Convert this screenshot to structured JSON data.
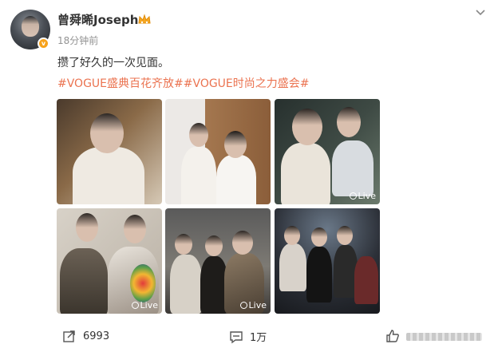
{
  "post": {
    "username": "曾舜晞Joseph",
    "timestamp": "18分钟前",
    "text": "攒了好久的一次见面。",
    "hashtags": "#VOGUE盛典百花齐放##VOGUE时尚之力盛会#"
  },
  "photos": [
    {
      "live": ""
    },
    {
      "live": ""
    },
    {
      "live": "Live"
    },
    {
      "live": "Live"
    },
    {
      "live": "Live"
    },
    {
      "live": ""
    }
  ],
  "actions": {
    "share_count": "6993",
    "comment_count": "1万"
  },
  "colors": {
    "hashtag": "#eb7350",
    "meta_gray": "#939393",
    "badge": "#f7a21b"
  }
}
